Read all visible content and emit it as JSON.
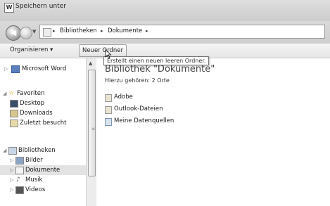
{
  "window": {
    "title": "Speichern unter",
    "app_icon_letter": "W"
  },
  "address": {
    "path": [
      "Bibliotheken",
      "Dokumente"
    ]
  },
  "toolbar": {
    "organize": "Organisieren",
    "organize_arrow": "▾",
    "new_folder": "Neuer Ordner"
  },
  "tooltip": "Erstellt einen neuen leeren Ordner.",
  "sidebar": {
    "word": "Microsoft Word",
    "favorites": "Favoriten",
    "desktop": "Desktop",
    "downloads": "Downloads",
    "recent": "Zuletzt besucht",
    "libraries": "Bibliotheken",
    "pictures": "Bilder",
    "documents": "Dokumente",
    "music": "Musik",
    "videos": "Videos"
  },
  "content": {
    "title": "Bibliothek \"Dokumente\"",
    "subtitle": "Hierzu gehören: 2 Orte",
    "items": [
      "Adobe",
      "Outlook-Dateien",
      "Meine Datenquellen"
    ]
  }
}
